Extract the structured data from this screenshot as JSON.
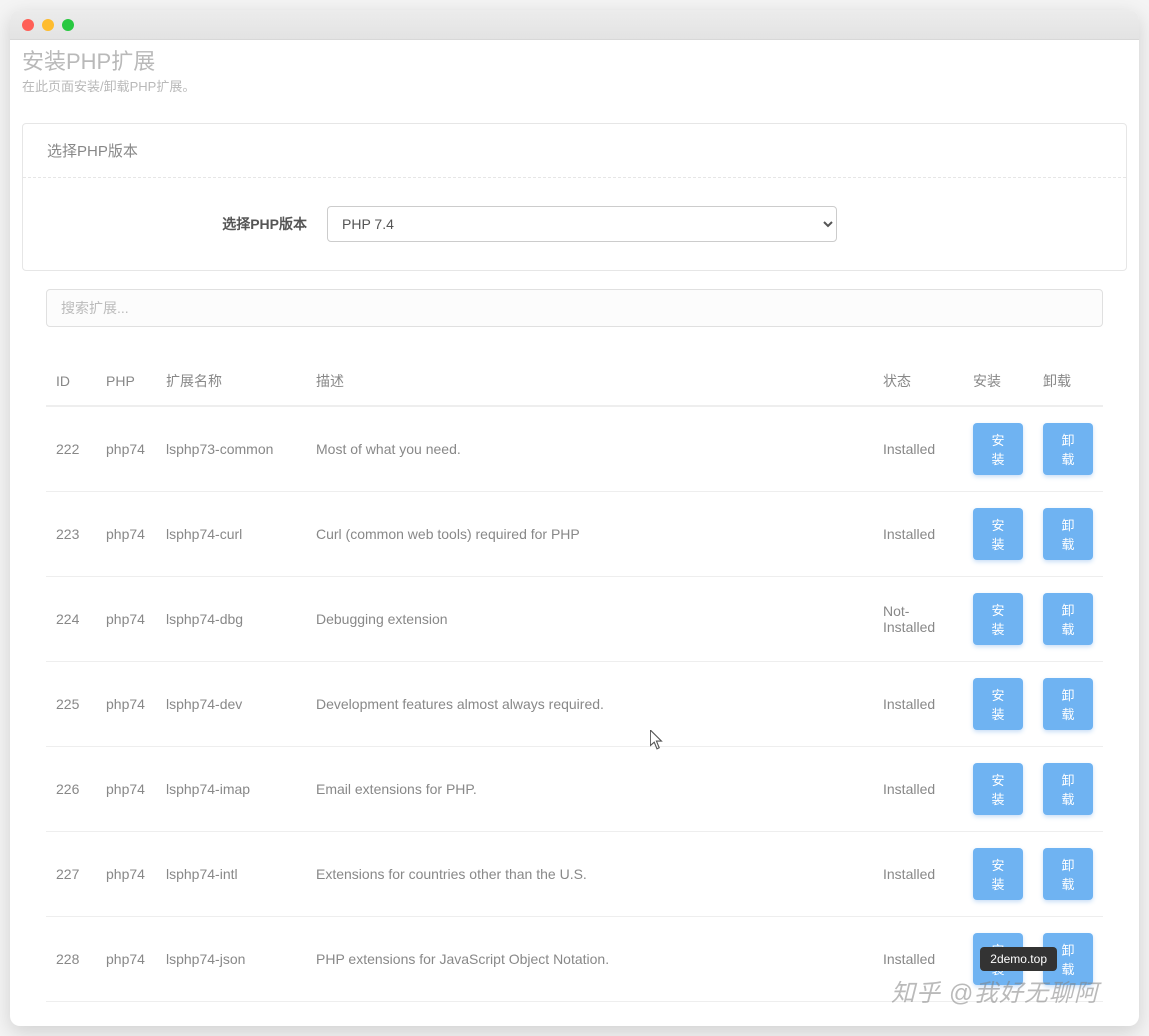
{
  "page": {
    "title": "安装PHP扩展",
    "subtitle": "在此页面安装/卸载PHP扩展。"
  },
  "panel": {
    "heading": "选择PHP版本",
    "select_label": "选择PHP版本",
    "select_value": "PHP 7.4"
  },
  "search": {
    "placeholder": "搜索扩展..."
  },
  "table": {
    "headers": {
      "id": "ID",
      "php": "PHP",
      "name": "扩展名称",
      "desc": "描述",
      "state": "状态",
      "install": "安装",
      "uninstall": "卸载"
    },
    "buttons": {
      "install": "安装",
      "uninstall": "卸载"
    },
    "rows": [
      {
        "id": "222",
        "php": "php74",
        "name": "lsphp73-common",
        "desc": "Most of what you need.",
        "state": "Installed"
      },
      {
        "id": "223",
        "php": "php74",
        "name": "lsphp74-curl",
        "desc": "Curl (common web tools) required for PHP",
        "state": "Installed"
      },
      {
        "id": "224",
        "php": "php74",
        "name": "lsphp74-dbg",
        "desc": "Debugging extension",
        "state": "Not-Installed"
      },
      {
        "id": "225",
        "php": "php74",
        "name": "lsphp74-dev",
        "desc": "Development features almost always required.",
        "state": "Installed"
      },
      {
        "id": "226",
        "php": "php74",
        "name": "lsphp74-imap",
        "desc": "Email extensions for PHP.",
        "state": "Installed"
      },
      {
        "id": "227",
        "php": "php74",
        "name": "lsphp74-intl",
        "desc": "Extensions for countries other than the U.S.",
        "state": "Installed"
      },
      {
        "id": "228",
        "php": "php74",
        "name": "lsphp74-json",
        "desc": "PHP extensions for JavaScript Object Notation.",
        "state": "Installed"
      }
    ]
  },
  "tooltip": "2demo.top",
  "watermark": "知乎 @我好无聊阿"
}
